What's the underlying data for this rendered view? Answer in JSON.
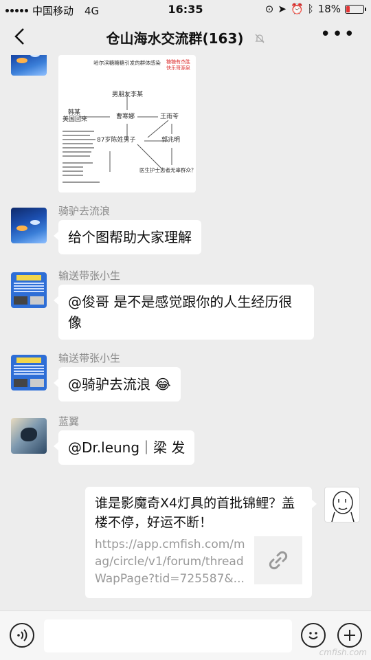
{
  "status_bar": {
    "carrier": "中国移动",
    "network": "4G",
    "time": "16:35",
    "battery_percent": "18%",
    "battery_level": 0.18,
    "battery_color": "#e33333"
  },
  "nav": {
    "back_icon": "chevron-left-icon",
    "title": "仓山海水交流群(163)",
    "mute_icon": "bell-mute-icon",
    "more_icon": "more-dots-icon"
  },
  "image_message": {
    "title": "哈尔滨糖糖糖引发的群体感染",
    "red_note_1": "糖糖有杰胜",
    "red_note_2": "快乐哥源泉",
    "nodes": {
      "han": "韩某",
      "us": "美国回来",
      "cao": "曹寒娜",
      "wang": "王雨苓",
      "boyfriend": "男朋友李某",
      "guo": "郭兆明",
      "man87": "87岁陈姓男子",
      "doctor": "医生护士患者无辜群众？？"
    }
  },
  "messages": [
    {
      "sender": "骑驴去流浪",
      "text": "给个图帮助大家理解"
    },
    {
      "sender": "输送带张小生",
      "text": "@俊哥 是不是感觉跟你的人生经历很像"
    },
    {
      "sender": "输送带张小生",
      "text": "@骑驴去流浪 😂"
    },
    {
      "sender": "蓝翼",
      "text": "@Dr.leung｜梁 发"
    }
  ],
  "link_card": {
    "title": "谁是影魔奇X4灯具的首批锦鲤？盖楼不停，好运不断！",
    "url": "https://app.cmfish.com/mag/circle/v1/forum/threadWapPage?tid=725587&...",
    "thumb_icon": "link-icon"
  },
  "input_bar": {
    "voice_icon": "voice-icon",
    "emoji_icon": "emoji-icon",
    "plus_icon": "plus-icon",
    "watermark": "cmfish.com"
  }
}
